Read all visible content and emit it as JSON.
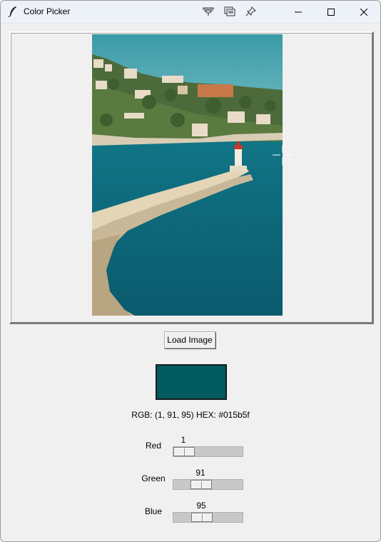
{
  "window": {
    "title": "Color Picker",
    "app_icon": "feather-icon",
    "toolbar_icons": [
      "pin-filter-icon",
      "window-cascade-icon",
      "pushpin-icon"
    ],
    "controls": [
      "minimize-icon",
      "maximize-icon",
      "close-icon"
    ]
  },
  "image": {
    "description_icon": "harbor-photo"
  },
  "load_button": {
    "label": "Load Image"
  },
  "swatch": {
    "color": "#015b5f"
  },
  "color_info": {
    "text": "RGB: (1, 91, 95) HEX: #015b5f"
  },
  "sliders": [
    {
      "label": "Red",
      "value": "1",
      "fraction": 0.004
    },
    {
      "label": "Green",
      "value": "91",
      "fraction": 0.357
    },
    {
      "label": "Blue",
      "value": "95",
      "fraction": 0.373
    }
  ]
}
